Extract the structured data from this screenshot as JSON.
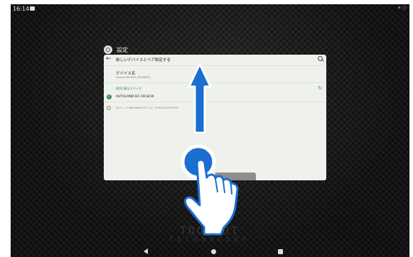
{
  "status_bar": {
    "time": "16:14",
    "right_indicators": "* ♡"
  },
  "app": {
    "title": "設定"
  },
  "pair_screen": {
    "toolbar_title": "新しいデバイスとペア設定する",
    "device_name_label": "デバイス名",
    "device_name_value": "Lenovo Tab M10 (TB-X605F)",
    "available_devices_header": "使用可能なデバイス",
    "devices": [
      {
        "name": "AUTOLAND:D4 19C8/19"
      }
    ],
    "footer_info": "タブレットのBluetoothアドレス: 70:9D:2D:24:F4:DF"
  },
  "watermark": {
    "line1": "TOOLBOT",
    "line2": "TECHNOLOGY"
  },
  "icons": {
    "back": "back-arrow-icon",
    "search": "search-icon",
    "refresh": "refresh-icon",
    "bluetooth": "bluetooth-icon",
    "info": "info-icon",
    "gesture": "swipe-up-gesture-icon"
  },
  "colors": {
    "accent": "#2f8a7a",
    "gesture_blue": "#1a6fd0",
    "card_bg": "#eef1ec"
  }
}
